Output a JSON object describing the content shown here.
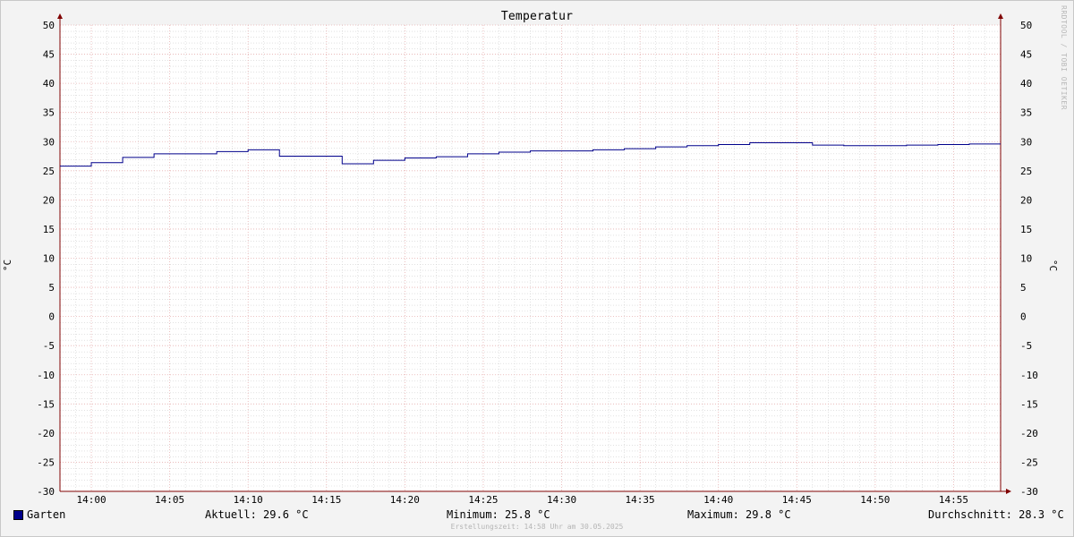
{
  "chart_data": {
    "type": "line",
    "title": "Temperatur",
    "ylabel": "°C",
    "ylim": [
      -30,
      50
    ],
    "yticks": [
      50,
      45,
      40,
      35,
      30,
      25,
      20,
      15,
      10,
      5,
      0,
      -5,
      -10,
      -15,
      -20,
      -25,
      -30
    ],
    "xlim": [
      "13:58",
      "14:58"
    ],
    "xticks": [
      "14:00",
      "14:05",
      "14:10",
      "14:15",
      "14:20",
      "14:25",
      "14:30",
      "14:35",
      "14:40",
      "14:45",
      "14:50",
      "14:55"
    ],
    "grid": true,
    "legend_position": "bottom",
    "series": [
      {
        "name": "Garten",
        "color": "#00008b",
        "step": true,
        "x": [
          "13:58",
          "14:00",
          "14:02",
          "14:04",
          "14:06",
          "14:08",
          "14:10",
          "14:12",
          "14:14",
          "14:16",
          "14:18",
          "14:20",
          "14:22",
          "14:24",
          "14:26",
          "14:28",
          "14:30",
          "14:32",
          "14:34",
          "14:36",
          "14:38",
          "14:40",
          "14:42",
          "14:44",
          "14:46",
          "14:48",
          "14:50",
          "14:52",
          "14:54",
          "14:56",
          "14:58"
        ],
        "values": [
          25.8,
          26.4,
          27.3,
          27.9,
          27.9,
          28.3,
          28.6,
          27.5,
          27.5,
          26.2,
          26.8,
          27.2,
          27.4,
          27.9,
          28.2,
          28.4,
          28.4,
          28.6,
          28.8,
          29.1,
          29.3,
          29.5,
          29.8,
          29.8,
          29.4,
          29.3,
          29.3,
          29.4,
          29.5,
          29.6,
          29.6
        ]
      }
    ]
  },
  "legend": {
    "series_name": "Garten",
    "aktuell": "Aktuell: 29.6 °C",
    "minimum": "Minimum: 25.8 °C",
    "maximum": "Maximum: 29.8 °C",
    "durchschnitt": "Durchschnitt: 28.3 °C"
  },
  "footer": "Erstellungszeit: 14:58 Uhr am 30.05.2025",
  "watermark": "RRDTOOL / TOBI OETIKER",
  "colors": {
    "line": "#00008b",
    "grid_major": "#e6b0b0",
    "grid_minor": "#d0d0d0",
    "axis": "#800000",
    "plot_bg": "#ffffff"
  }
}
